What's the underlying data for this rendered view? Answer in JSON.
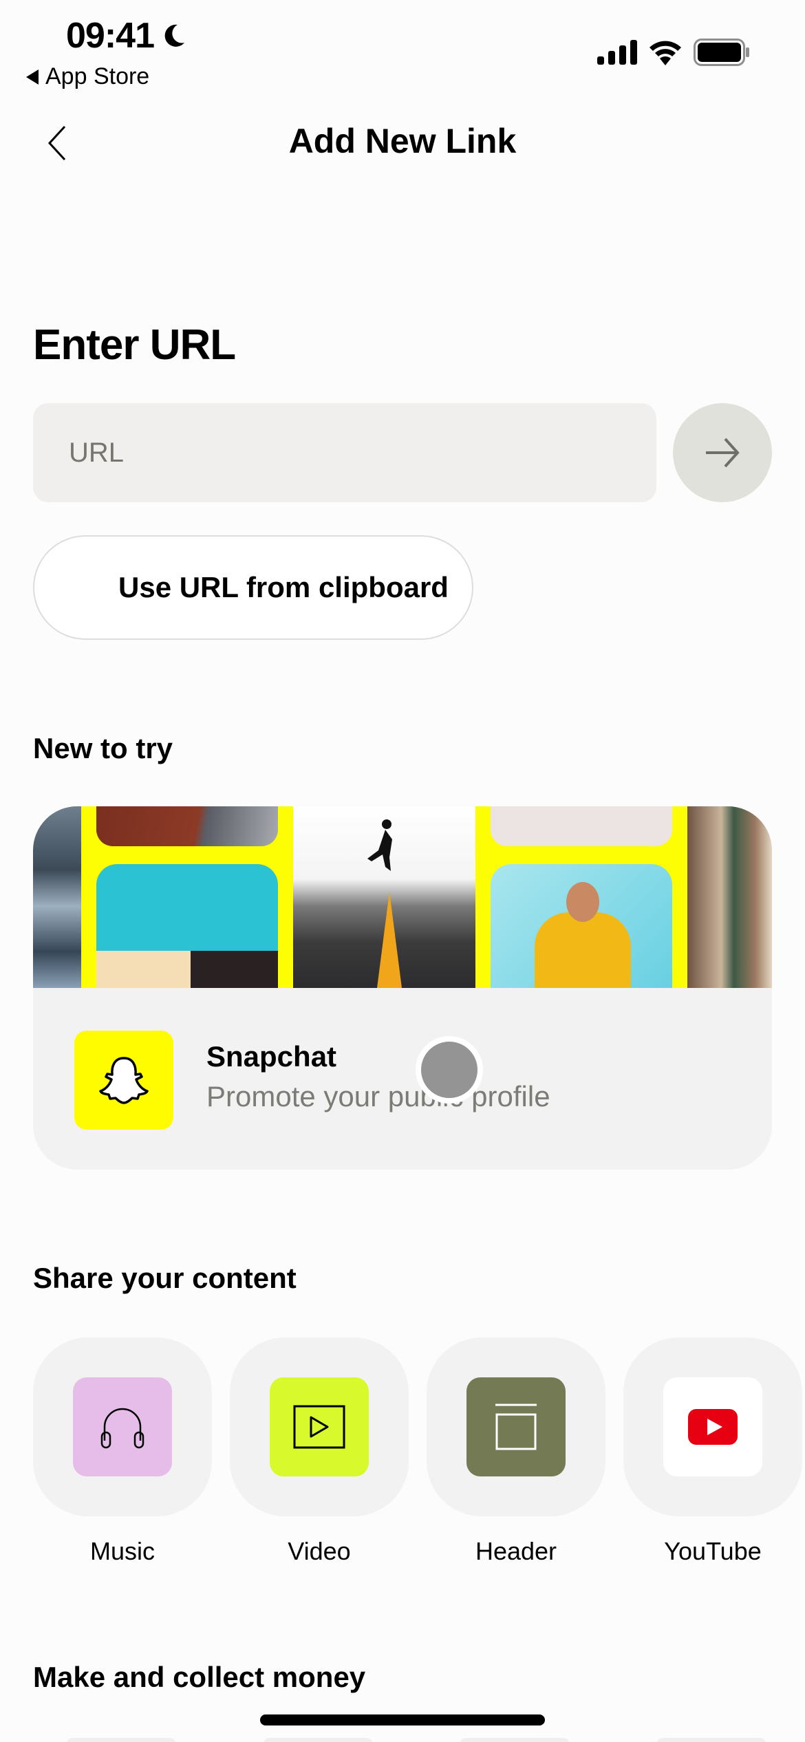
{
  "status_bar": {
    "time": "09:41",
    "back_app_label": "App Store",
    "icons": [
      "moon-icon",
      "cellular-signal-icon",
      "wifi-icon",
      "battery-icon"
    ]
  },
  "nav": {
    "back_icon": "chevron-left-icon",
    "title": "Add New Link"
  },
  "enter_url": {
    "heading": "Enter URL",
    "input_value": "",
    "input_placeholder": "URL",
    "submit_icon": "arrow-right-icon",
    "clipboard_button_label": "Use URL from clipboard"
  },
  "new_to_try": {
    "heading": "New to try",
    "card": {
      "title": "Snapchat",
      "subtitle": "Promote your public profile",
      "icon": "snapchat-ghost-icon",
      "brand_color": "#FFFC00"
    }
  },
  "share_content": {
    "heading": "Share your content",
    "items": [
      {
        "label": "Music",
        "icon": "headphones-icon",
        "color": "#E6BDE8"
      },
      {
        "label": "Video",
        "icon": "video-play-icon",
        "color": "#D8F92B"
      },
      {
        "label": "Header",
        "icon": "header-layout-icon",
        "color": "#747A53"
      },
      {
        "label": "YouTube",
        "icon": "youtube-icon",
        "color": "#FFFFFF"
      }
    ]
  },
  "make_money": {
    "heading": "Make and collect money"
  }
}
